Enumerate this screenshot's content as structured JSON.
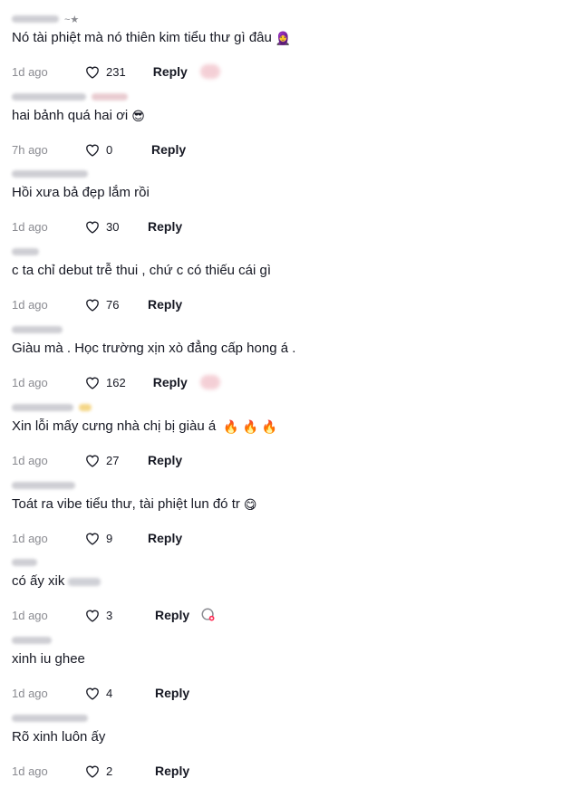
{
  "colors": {
    "text": "#161823",
    "muted": "#8a8b91",
    "accent": "#fe2c55"
  },
  "comments": [
    {
      "username_suffix": "~★",
      "text": "Nó tài phiệt mà nó thiên kim tiểu thư gì đâu",
      "emoji": "🧕",
      "time": "1d ago",
      "likes": "231",
      "reply": "Reply",
      "reaction": "liked-by-creator"
    },
    {
      "username_suffix": "",
      "text": "hai bảnh quá hai ơi",
      "emoji": "😎",
      "time": "7h ago",
      "likes": "0",
      "reply": "Reply",
      "reaction": ""
    },
    {
      "username_suffix": "",
      "text": "Hồi xưa bả đẹp lắm rồi",
      "emoji": "",
      "time": "1d ago",
      "likes": "30",
      "reply": "Reply",
      "reaction": ""
    },
    {
      "username_suffix": "",
      "text": "c ta chỉ debut trễ thui , chứ c có thiếu cái gì",
      "emoji": "",
      "time": "1d ago",
      "likes": "76",
      "reply": "Reply",
      "reaction": ""
    },
    {
      "username_suffix": "",
      "text": "Giàu mà . Học trường xịn xò đẳng cấp hong á .",
      "emoji": "",
      "time": "1d ago",
      "likes": "162",
      "reply": "Reply",
      "reaction": "liked-by-creator"
    },
    {
      "username_suffix": "",
      "text": "Xin lỗi mấy cưng nhà chị bị giàu á",
      "emoji": "🔥 🔥 🔥",
      "time": "1d ago",
      "likes": "27",
      "reply": "Reply",
      "reaction": ""
    },
    {
      "username_suffix": "",
      "text": "Toát ra vibe tiểu thư, tài phiệt lun đó tr",
      "emoji": "😋",
      "time": "1d ago",
      "likes": "9",
      "reply": "Reply",
      "reaction": ""
    },
    {
      "username_suffix": "",
      "text": "có ấy xik",
      "emoji": "",
      "time": "1d ago",
      "likes": "3",
      "reply": "Reply",
      "reaction": "creator-avatar"
    },
    {
      "username_suffix": "",
      "text": "xinh iu ghee",
      "emoji": "",
      "time": "1d ago",
      "likes": "4",
      "reply": "Reply",
      "reaction": ""
    },
    {
      "username_suffix": "",
      "text": "Rõ xinh luôn ấy",
      "emoji": "",
      "time": "1d ago",
      "likes": "2",
      "reply": "Reply",
      "reaction": ""
    }
  ]
}
